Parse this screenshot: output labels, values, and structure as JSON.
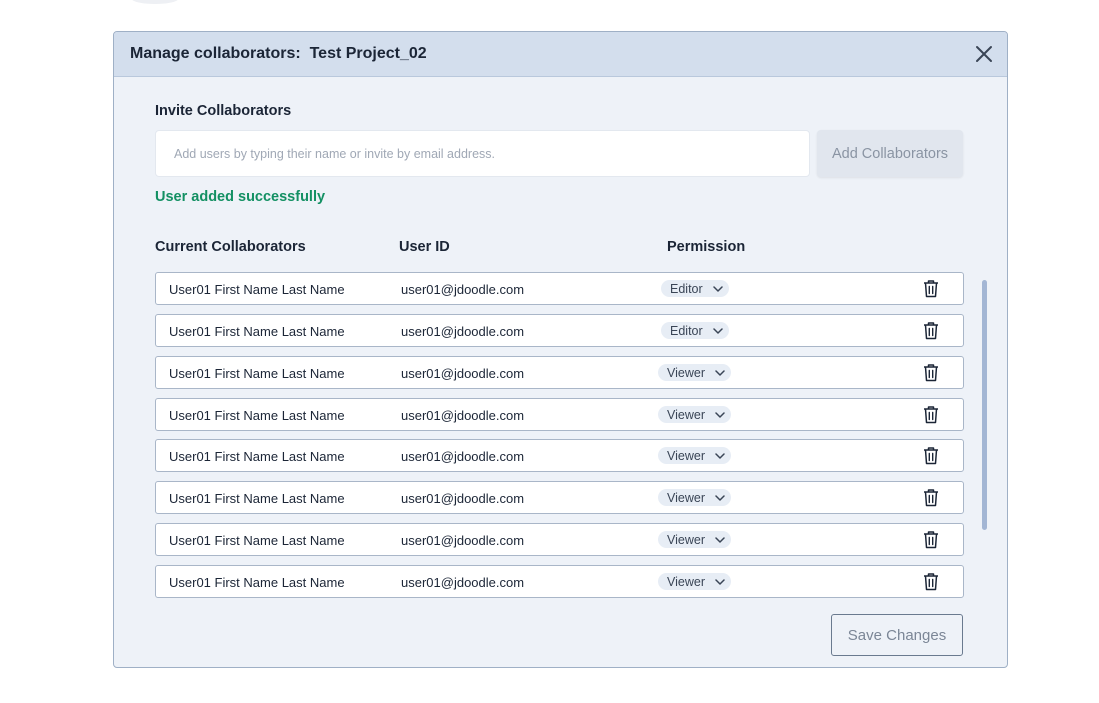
{
  "modal": {
    "title_prefix": "Manage collaborators:",
    "project_name": "Test Project_02",
    "close_icon": "close-icon"
  },
  "invite": {
    "label": "Invite Collaborators",
    "placeholder": "Add users by typing their name or invite by email address.",
    "value": "",
    "button_label": "Add Collaborators",
    "success_message": "User added successfully"
  },
  "table": {
    "headers": [
      "Current Collaborators",
      "User ID",
      "Permission"
    ],
    "rows": [
      {
        "name": "User01 First Name Last Name",
        "user_id": "user01@jdoodle.com",
        "permission": "Editor"
      },
      {
        "name": "User01 First Name Last Name",
        "user_id": "user01@jdoodle.com",
        "permission": "Editor"
      },
      {
        "name": "User01 First Name Last Name",
        "user_id": "user01@jdoodle.com",
        "permission": "Viewer"
      },
      {
        "name": "User01 First Name Last Name",
        "user_id": "user01@jdoodle.com",
        "permission": "Viewer"
      },
      {
        "name": "User01 First Name Last Name",
        "user_id": "user01@jdoodle.com",
        "permission": "Viewer"
      },
      {
        "name": "User01 First Name Last Name",
        "user_id": "user01@jdoodle.com",
        "permission": "Viewer"
      },
      {
        "name": "User01 First Name Last Name",
        "user_id": "user01@jdoodle.com",
        "permission": "Viewer"
      },
      {
        "name": "User01 First Name Last Name",
        "user_id": "user01@jdoodle.com",
        "permission": "Viewer"
      }
    ]
  },
  "footer": {
    "save_label": "Save Changes"
  },
  "colors": {
    "header_bg": "#d3deed",
    "modal_bg": "#eef2f8",
    "success": "#139063",
    "scrollbar": "#a3b6d4"
  }
}
